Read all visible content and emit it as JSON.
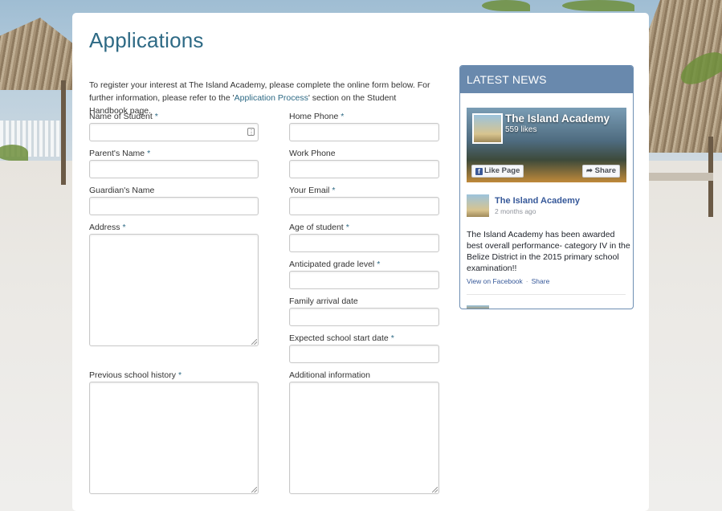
{
  "page": {
    "title": "Applications",
    "intro_before": "To register your interest at The Island Academy, please complete the online form below. For further information, please refer to the '",
    "intro_link": "Application Process",
    "intro_after": "' section on the Student Handbook page."
  },
  "form": {
    "required_marker": "*",
    "left": {
      "student_name": "Name of Student",
      "parent_name": "Parent's Name",
      "guardian_name": "Guardian's Name",
      "address": "Address",
      "previous_history": "Previous school history"
    },
    "right": {
      "home_phone": "Home Phone",
      "work_phone": "Work Phone",
      "email": "Your Email",
      "age": "Age of student",
      "grade": "Anticipated grade level",
      "arrival": "Family arrival date",
      "start_date": "Expected school start date",
      "additional": "Additional information"
    }
  },
  "news": {
    "heading": "LATEST NEWS",
    "fb_page_name": "The Island Academy",
    "fb_likes": "559 likes",
    "like_label": "Like Page",
    "share_label": "Share",
    "post_author": "The Island Academy",
    "post_time": "2 months ago",
    "post_text": "The Island Academy has been awarded best overall performance- category IV in the Belize District in the 2015 primary school examination!!",
    "view_on_facebook": "View on Facebook",
    "separator": "·",
    "post_share": "Share"
  }
}
